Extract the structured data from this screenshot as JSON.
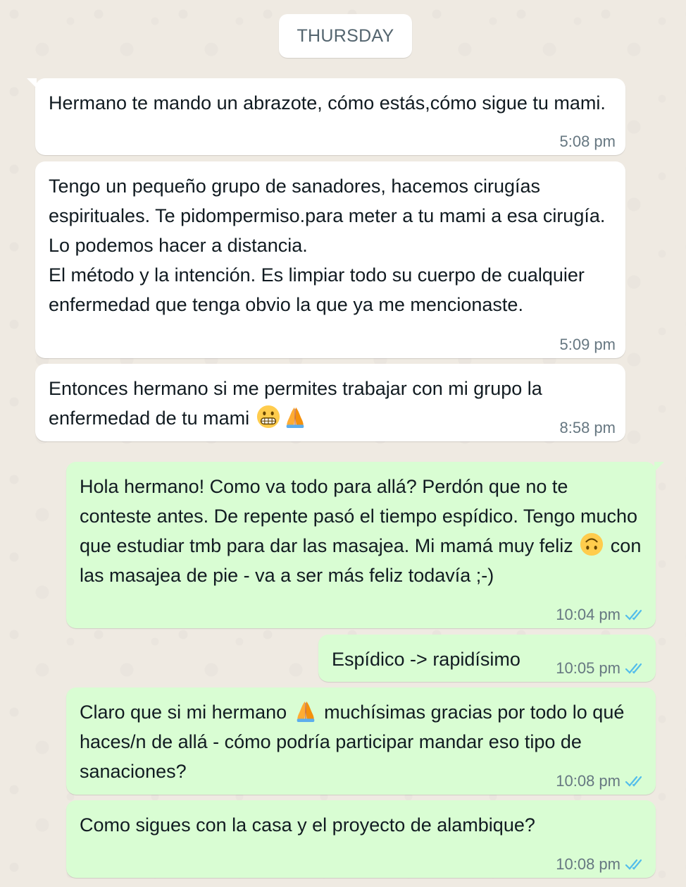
{
  "date_divider": "THURSDAY",
  "colors": {
    "background": "#efeae2",
    "incoming_bubble": "#ffffff",
    "outgoing_bubble": "#d9fdd3",
    "read_tick": "#53bdeb",
    "meta_text": "#667781"
  },
  "messages": [
    {
      "direction": "incoming",
      "text": "Hermano te mando un abrazote, cómo estás,cómo sigue tu mami.",
      "time": "5:08 pm"
    },
    {
      "direction": "incoming",
      "text": "Tengo un pequeño grupo de sanadores, hacemos cirugías espirituales. Te pidompermiso.para meter a tu mami a esa cirugía. Lo podemos hacer a distancia.\nEl método y la intención. Es limpiar todo su cuerpo de cualquier enfermedad que tenga obvio la que ya me mencionaste.",
      "time": "5:09 pm"
    },
    {
      "direction": "incoming",
      "text_before": "Entonces hermano si me permites trabajar con mi grupo la enfermedad de tu mami ",
      "emojis": [
        "grimacing-face-emoji",
        "folded-hands-emoji"
      ],
      "time": "8:58 pm"
    },
    {
      "direction": "outgoing",
      "text_before": "Hola hermano! Como va todo para allá? Perdón que no te conteste antes. De repente pasó el tiempo espídico. Tengo mucho que estudiar tmb para dar las masajea. Mi mamá muy feliz ",
      "emoji": "upside-down-face-emoji",
      "text_after": " con las masajea de pie - va a ser más feliz todavía ;-)",
      "time": "10:04 pm",
      "status": "read"
    },
    {
      "direction": "outgoing",
      "text": "Espídico -> rapidísimo",
      "time": "10:05 pm",
      "status": "read"
    },
    {
      "direction": "outgoing",
      "text_before": "Claro que si mi hermano ",
      "emoji": "folded-hands-emoji",
      "text_after": " muchísimas gracias por todo lo qué haces/n de allá - cómo podría participar mandar eso tipo de sanaciones?",
      "time": "10:08 pm",
      "status": "read"
    },
    {
      "direction": "outgoing",
      "text": "Como sigues con la casa y el proyecto de alambique?",
      "time": "10:08 pm",
      "status": "read"
    }
  ]
}
